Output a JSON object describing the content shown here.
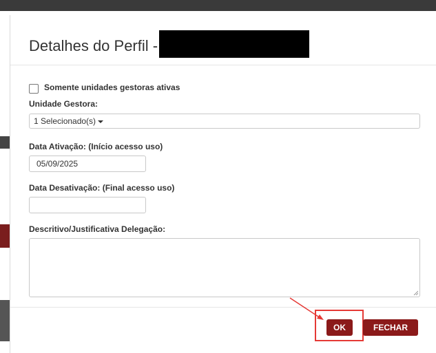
{
  "modal": {
    "title": "Detalhes do Perfil -"
  },
  "form": {
    "active_units_checkbox_label": "Somente unidades gestoras ativas",
    "active_units_checked": false,
    "managing_unit_label": "Unidade Gestora:",
    "managing_unit_value": "1 Selecionado(s)",
    "activation_date_label": "Data Ativação: (Início acesso uso)",
    "activation_date_value": "05/09/2025",
    "deactivation_date_label": "Data Desativação: (Final acesso uso)",
    "deactivation_date_value": "",
    "justification_label": "Descritivo/Justificativa Delegação:",
    "justification_value": ""
  },
  "footer": {
    "ok_label": "OK",
    "close_label": "FECHAR"
  },
  "colors": {
    "button_bg": "#8b1a1a",
    "annotation": "#e53935"
  },
  "icons": {
    "dropdown": "caret-down-icon",
    "resize": "resize-handle-icon"
  }
}
